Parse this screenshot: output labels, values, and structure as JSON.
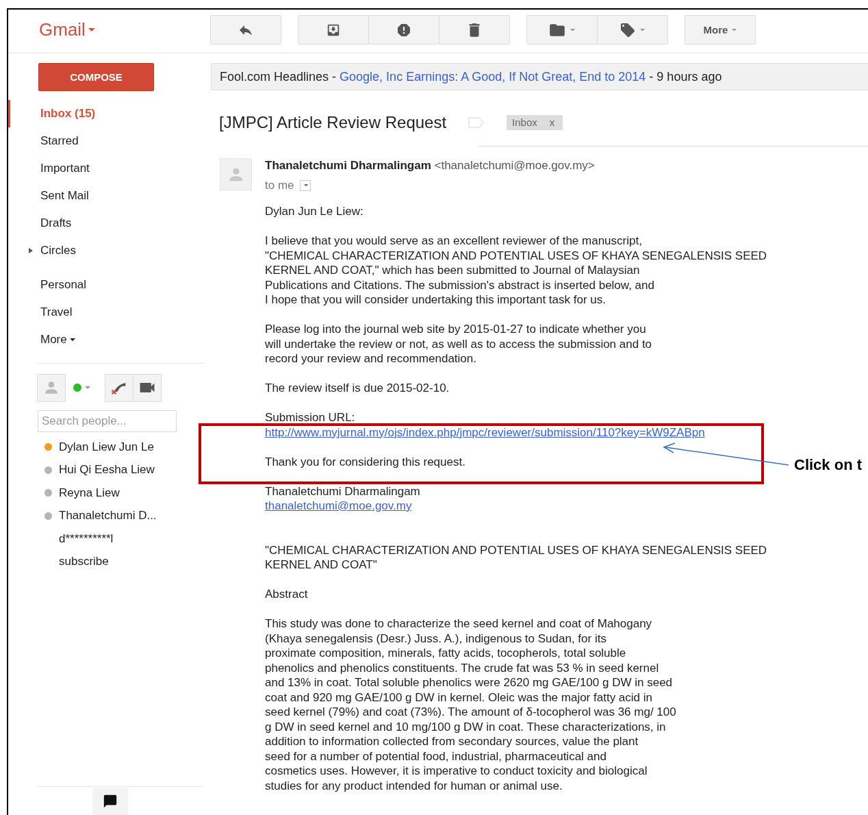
{
  "header": {
    "logo": "Gmail",
    "more_button": "More"
  },
  "sidebar": {
    "compose": "COMPOSE",
    "items": [
      {
        "label": "Inbox (15)",
        "kind": "label",
        "selected": true
      },
      {
        "label": "Starred",
        "kind": "label",
        "selected": false
      },
      {
        "label": "Important",
        "kind": "label",
        "selected": false
      },
      {
        "label": "Sent Mail",
        "kind": "label",
        "selected": false
      },
      {
        "label": "Drafts",
        "kind": "label",
        "selected": false
      },
      {
        "label": "Circles",
        "kind": "group",
        "selected": false,
        "expanded": false
      },
      {
        "label": "Personal",
        "kind": "label",
        "selected": false
      },
      {
        "label": "Travel",
        "kind": "label",
        "selected": false
      },
      {
        "label": "More",
        "kind": "more",
        "selected": false
      }
    ],
    "chat": {
      "search_placeholder": "Search people...",
      "contacts": [
        {
          "name": "Dylan Liew Jun Le",
          "color": "#f39c1f"
        },
        {
          "name": "Hui Qi Eesha Liew",
          "color": "#b5b5b5"
        },
        {
          "name": "Reyna Liew",
          "color": "#b5b5b5"
        },
        {
          "name": "Thanaletchumi D...",
          "color": "#b5b5b5"
        },
        {
          "name": "d**********l"
        },
        {
          "name": "subscribe"
        }
      ]
    }
  },
  "web_clip": {
    "source": "Fool.com Headlines - ",
    "headline": "Google, Inc Earnings: A Good, If Not Great, End to 2014",
    "age": " - 9 hours ago"
  },
  "message": {
    "subject": "[JMPC] Article Review Request",
    "labels": [
      {
        "text": "Inbox",
        "remove": "x"
      }
    ],
    "sender_name": "Thanaletchumi Dharmalingam",
    "sender_address": "<thanaletchumi@moe.gov.my>",
    "recipient": "to me",
    "body": [
      {
        "kind": "paragraph",
        "items": [
          {
            "kind": "text",
            "text": "Dylan Jun Le Liew:"
          }
        ]
      },
      {
        "kind": "paragraph",
        "items": [
          {
            "kind": "text",
            "text": "I believe that you would serve as an excellent reviewer of the manuscript,\n\"CHEMICAL CHARACTERIZATION AND POTENTIAL USES OF KHAYA SENEGALENSIS SEED\nKERNEL AND COAT,\" which has been submitted to Journal of Malaysian\nPublications and Citations. The submission's abstract is inserted below, and\nI hope that you will consider undertaking this important task for us."
          }
        ]
      },
      {
        "kind": "paragraph",
        "items": [
          {
            "kind": "text",
            "text": "Please log into the journal web site by 2015-01-27 to indicate whether you\nwill undertake the review or not, as well as to access the submission and to\nrecord your review and recommendation."
          }
        ]
      },
      {
        "kind": "paragraph",
        "items": [
          {
            "kind": "text",
            "text": "The review itself is due 2015-02-10."
          }
        ]
      },
      {
        "kind": "paragraph",
        "items": [
          {
            "kind": "text",
            "text": "Submission URL:"
          },
          {
            "kind": "link",
            "text": "http://www.myjurnal.my/ojs/index.php/jmpc/reviewer/submission/110?key=kW9ZABpn"
          }
        ]
      },
      {
        "kind": "paragraph",
        "items": [
          {
            "kind": "text",
            "text": "Thank you for considering this request."
          }
        ]
      },
      {
        "kind": "paragraph",
        "items": [
          {
            "kind": "text",
            "text": "Thanaletchumi Dharmalingam"
          },
          {
            "kind": "link",
            "text": "thanaletchumi@moe.gov.my"
          }
        ]
      },
      {
        "kind": "quoted",
        "items": [
          {
            "kind": "text",
            "text": "\"CHEMICAL CHARACTERIZATION AND POTENTIAL USES OF KHAYA SENEGALENSIS SEED\nKERNEL AND COAT\""
          }
        ]
      },
      {
        "kind": "paragraph",
        "items": [
          {
            "kind": "text",
            "text": "Abstract"
          }
        ]
      },
      {
        "kind": "paragraph",
        "items": [
          {
            "kind": "text",
            "text": "This study was done to characterize the seed kernel and coat of Mahogany\n(Khaya senegalensis (Desr.) Juss. A.), indigenous to Sudan, for its\nproximate composition, minerals, fatty acids, tocopherols, total soluble\nphenolics and phenolics constituents. The crude fat was 53 % in seed kernel\nand 13% in coat. Total soluble phenolics were 2620 mg GAE/100 g DW in seed\ncoat and 920 mg GAE/100 g DW in kernel. Oleic was the major fatty acid in\nseed kernel (79%) and coat (73%). The amount of δ-tocopherol was 36 mg/ 100\ng DW in seed kernel and 10 mg/100 g DW in coat. These characterizations, in\naddition to information collected from secondary sources, value the plant\nseed for a number of potential food, industrial, pharmaceutical and\ncosmetics uses. However, it is imperative to conduct toxicity and biological\nstudies for any product intended for human or animal use."
          }
        ]
      }
    ]
  },
  "annotation": {
    "text": "Click on t"
  }
}
